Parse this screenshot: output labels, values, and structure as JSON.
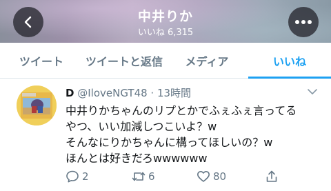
{
  "header": {
    "name": "中井りか",
    "likes_label": "いいね 6,315",
    "back_icon": "back-chevron-icon",
    "more_icon": "more-dots-icon"
  },
  "tabs": [
    {
      "label": "ツイート",
      "active": false
    },
    {
      "label": "ツイートと返信",
      "active": false
    },
    {
      "label": "メディア",
      "active": false
    },
    {
      "label": "いいね",
      "active": true
    }
  ],
  "tweet": {
    "display_name": "D",
    "handle_time": "@IloveNGT48 · 13時間",
    "text": "中井りかちゃんのリプとかでふぇふぇ言ってる\nやつ、いい加減しつこいよ？w\nそんなにりかちゃんに構ってほしいの？w\nほんとは好きだろwwwwww",
    "actions": {
      "reply_count": "2",
      "retweet_count": "6",
      "like_count": "80"
    }
  },
  "colors": {
    "accent": "#1da1f2",
    "muted": "#657786",
    "text": "#14171a"
  }
}
